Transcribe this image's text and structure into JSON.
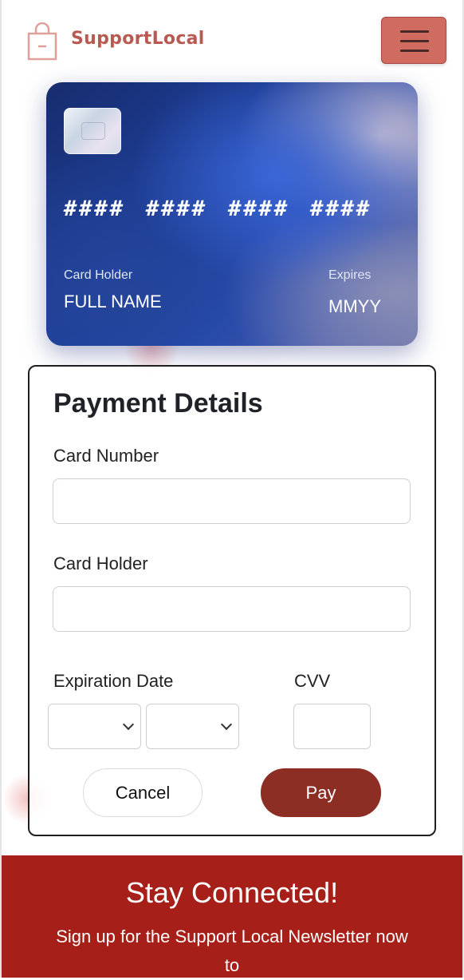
{
  "header": {
    "brand": "SupportLocal",
    "brand_color": "#b85a52",
    "logo_icon": "shopping-bag-icon",
    "menu_icon": "hamburger-menu-icon",
    "menu_button_color": "#cf6b5f"
  },
  "card": {
    "number_groups": [
      "####",
      "####",
      "####",
      "####"
    ],
    "holder_label": "Card Holder",
    "holder_value": "FULL NAME",
    "expires_label": "Expires",
    "expires_value": "MMYY"
  },
  "form": {
    "title": "Payment Details",
    "card_number_label": "Card Number",
    "card_number_value": "",
    "card_holder_label": "Card Holder",
    "card_holder_value": "",
    "expiration_label": "Expiration Date",
    "expiration_month_value": "",
    "expiration_year_value": "",
    "cvv_label": "CVV",
    "cvv_value": "",
    "cancel_label": "Cancel",
    "pay_label": "Pay",
    "pay_color": "#8c2e24"
  },
  "footer": {
    "title": "Stay Connected!",
    "text": "Sign up for the Support Local Newsletter now to",
    "background": "#a62019"
  }
}
